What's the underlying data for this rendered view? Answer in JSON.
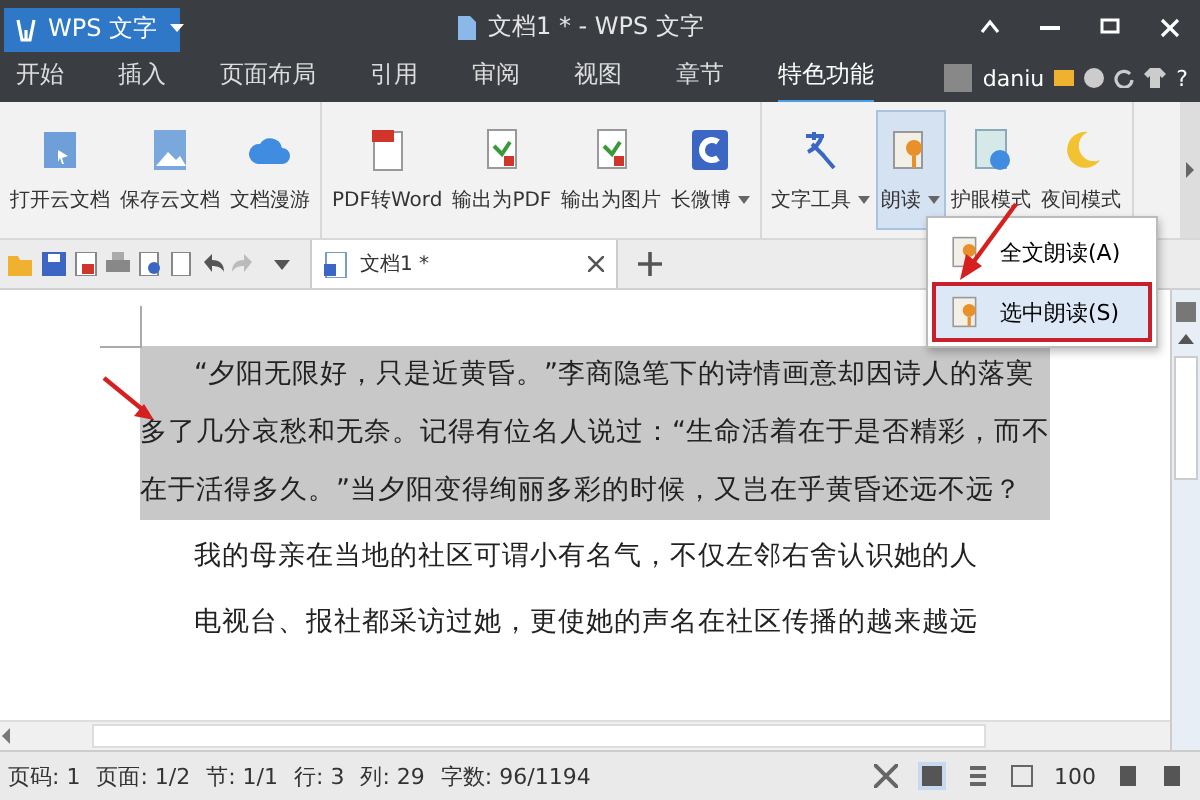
{
  "app_button": {
    "label": "WPS 文字"
  },
  "window": {
    "title": "文档1 * - WPS 文字"
  },
  "menu_tabs": [
    {
      "label": "开始",
      "selected": false
    },
    {
      "label": "插入",
      "selected": false
    },
    {
      "label": "页面布局",
      "selected": false
    },
    {
      "label": "引用",
      "selected": false
    },
    {
      "label": "审阅",
      "selected": false
    },
    {
      "label": "视图",
      "selected": false
    },
    {
      "label": "章节",
      "selected": false
    },
    {
      "label": "特色功能",
      "selected": true
    }
  ],
  "account": {
    "user": "daniu",
    "help": "?"
  },
  "ribbon": {
    "groups": [
      [
        {
          "label": "打开云文档",
          "kind": "folder",
          "dropdown": false,
          "pressed": false
        },
        {
          "label": "保存云文档",
          "kind": "picture",
          "dropdown": false,
          "pressed": false
        },
        {
          "label": "文档漫游",
          "kind": "cloud",
          "dropdown": false,
          "pressed": false
        }
      ],
      [
        {
          "label": "PDF转Word",
          "kind": "pdf",
          "dropdown": false,
          "pressed": false
        },
        {
          "label": "输出为PDF",
          "kind": "page",
          "dropdown": false,
          "pressed": false
        },
        {
          "label": "输出为图片",
          "kind": "page",
          "dropdown": false,
          "pressed": false
        },
        {
          "label": "长微博",
          "kind": "weibo",
          "dropdown": true,
          "pressed": false
        }
      ],
      [
        {
          "label": "文字工具",
          "kind": "text",
          "dropdown": true,
          "pressed": false
        },
        {
          "label": "朗读",
          "kind": "read",
          "dropdown": true,
          "pressed": true
        },
        {
          "label": "护眼模式",
          "kind": "eye",
          "dropdown": false,
          "pressed": false
        },
        {
          "label": "夜间模式",
          "kind": "moon",
          "dropdown": false,
          "pressed": false
        }
      ]
    ]
  },
  "doc_tabs": [
    {
      "label": "文档1 *",
      "selected": true
    }
  ],
  "dropdown_menu": {
    "items": [
      {
        "label": "全文朗读(A)",
        "selected": false
      },
      {
        "label": "选中朗读(S)",
        "selected": true
      }
    ]
  },
  "document": {
    "paragraphs": [
      {
        "text": "“夕阳无限好，只是近黄昏。”李商隐笔下的诗情画意却因诗人的落寞多了几分哀愁和无奈。记得有位名人说过：“生命活着在于是否精彩，而不在于活得多久。”当夕阳变得绚丽多彩的时候，又岂在乎黄昏还远不远？",
        "selected": true
      },
      {
        "text": "我的母亲在当地的社区可谓小有名气，不仅左邻右舍认识她的人",
        "selected": false
      },
      {
        "text": "电视台、报社都采访过她，更使她的声名在社区传播的越来越远",
        "selected": false
      }
    ]
  },
  "status_bar": {
    "fields": [
      "页码: 1",
      "页面: 1/2",
      "节: 1/1",
      "行: 3",
      "列: 29",
      "字数: 96/1194"
    ],
    "zoom": "100"
  }
}
